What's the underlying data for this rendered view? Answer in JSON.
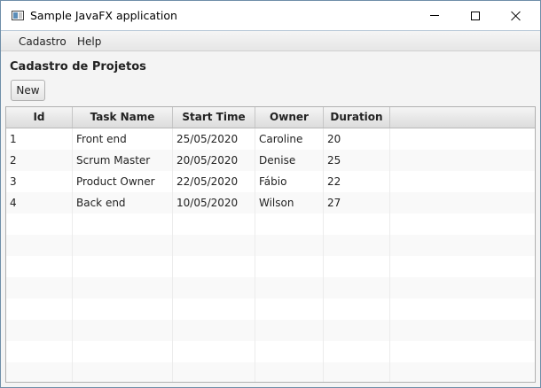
{
  "window": {
    "title": "Sample JavaFX application",
    "app_icon": "app-window-icon"
  },
  "menubar": {
    "items": [
      {
        "label": "Cadastro"
      },
      {
        "label": "Help"
      }
    ]
  },
  "page": {
    "heading": "Cadastro de Projetos",
    "new_button": "New"
  },
  "table": {
    "columns": [
      "Id",
      "Task Name",
      "Start Time",
      "Owner",
      "Duration"
    ],
    "rows": [
      [
        "1",
        "Front end",
        "25/05/2020",
        "Caroline",
        "20"
      ],
      [
        "2",
        "Scrum Master",
        "20/05/2020",
        "Denise",
        "25"
      ],
      [
        "3",
        "Product Owner",
        "22/05/2020",
        "Fábio",
        "22"
      ],
      [
        "4",
        "Back end",
        "10/05/2020",
        "Wilson",
        "27"
      ],
      [
        "",
        "",
        "",
        "",
        ""
      ],
      [
        "",
        "",
        "",
        "",
        ""
      ],
      [
        "",
        "",
        "",
        "",
        ""
      ],
      [
        "",
        "",
        "",
        "",
        ""
      ],
      [
        "",
        "",
        "",
        "",
        ""
      ],
      [
        "",
        "",
        "",
        "",
        ""
      ],
      [
        "",
        "",
        "",
        "",
        ""
      ],
      [
        "",
        "",
        "",
        "",
        ""
      ]
    ]
  },
  "colors": {
    "window_border": "#6f8ea8",
    "header_bg": "#dcdcdc",
    "row_alt": "#f9f9f9"
  }
}
